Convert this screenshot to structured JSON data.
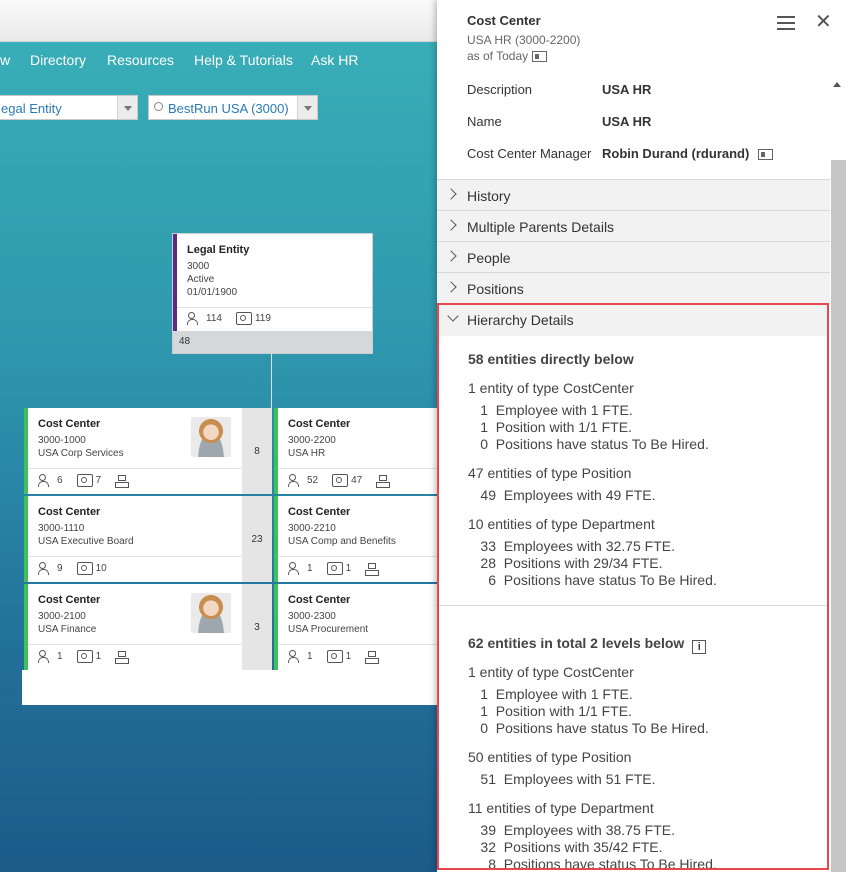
{
  "nav": {
    "items": [
      "w",
      "Directory",
      "Resources",
      "Help & Tutorials",
      "Ask HR"
    ]
  },
  "filters": {
    "type_value": "egal Entity",
    "company_value": "BestRun USA (3000)"
  },
  "chart": {
    "root": {
      "title": "Legal Entity",
      "code": "3000",
      "status": "Active",
      "date": "01/01/1900",
      "people": "114",
      "positions": "119",
      "footer": "48"
    },
    "left": [
      {
        "title": "Cost Center",
        "code": "3000-1000",
        "name": "USA Corp Services",
        "people": "6",
        "positions": "7",
        "count": "8"
      },
      {
        "title": "Cost Center",
        "code": "3000-1110",
        "name": "USA Executive Board",
        "people": "9",
        "positions": "10",
        "count": "23"
      },
      {
        "title": "Cost Center",
        "code": "3000-2100",
        "name": "USA Finance",
        "people": "1",
        "positions": "1",
        "count": "3"
      }
    ],
    "right": [
      {
        "title": "Cost Center",
        "code": "3000-2200",
        "name": "USA HR",
        "people": "52",
        "positions": "47"
      },
      {
        "title": "Cost Center",
        "code": "3000-2210",
        "name": "USA Comp and Benefits",
        "people": "1",
        "positions": "1"
      },
      {
        "title": "Cost Center",
        "code": "3000-2300",
        "name": "USA Procurement",
        "people": "1",
        "positions": "1"
      }
    ]
  },
  "panel": {
    "title": "Cost Center",
    "subtitle": "USA HR (3000-2200)",
    "as_of": "as of Today",
    "fields": [
      {
        "label": "Description",
        "value": "USA HR"
      },
      {
        "label": "Name",
        "value": "USA HR"
      },
      {
        "label": "Cost Center Manager",
        "value": "Robin Durand (rdurand)"
      }
    ],
    "sections": [
      "History",
      "Multiple Parents Details",
      "People",
      "Positions",
      "Hierarchy Details"
    ],
    "hierarchy": {
      "direct_heading": "58 entities directly below",
      "direct_groups": [
        {
          "type": "1 entity of type CostCenter",
          "rows": [
            {
              "num": "1",
              "text": "Employee with 1 FTE."
            },
            {
              "num": "1",
              "text": "Position with 1/1 FTE."
            },
            {
              "num": "0",
              "text": "Positions have status To Be Hired."
            }
          ]
        },
        {
          "type": "47 entities of type Position",
          "rows": [
            {
              "num": "49",
              "text": "Employees with 49 FTE."
            }
          ]
        },
        {
          "type": "10 entities of type Department",
          "rows": [
            {
              "num": "33",
              "text": "Employees with 32.75 FTE."
            },
            {
              "num": "28",
              "text": "Positions with 29/34 FTE."
            },
            {
              "num": "6",
              "text": "Positions have status To Be Hired."
            }
          ]
        }
      ],
      "total_heading": "62 entities in total 2 levels below",
      "total_groups": [
        {
          "type": "1 entity of type CostCenter",
          "rows": [
            {
              "num": "1",
              "text": "Employee with 1 FTE."
            },
            {
              "num": "1",
              "text": "Position with 1/1 FTE."
            },
            {
              "num": "0",
              "text": "Positions have status To Be Hired."
            }
          ]
        },
        {
          "type": "50 entities of type Position",
          "rows": [
            {
              "num": "51",
              "text": "Employees with 51 FTE."
            }
          ]
        },
        {
          "type": "11 entities of type Department",
          "rows": [
            {
              "num": "39",
              "text": "Employees with 38.75 FTE."
            },
            {
              "num": "32",
              "text": "Positions with 35/42 FTE."
            },
            {
              "num": "8",
              "text": "Positions have status To Be Hired."
            }
          ]
        }
      ]
    }
  }
}
